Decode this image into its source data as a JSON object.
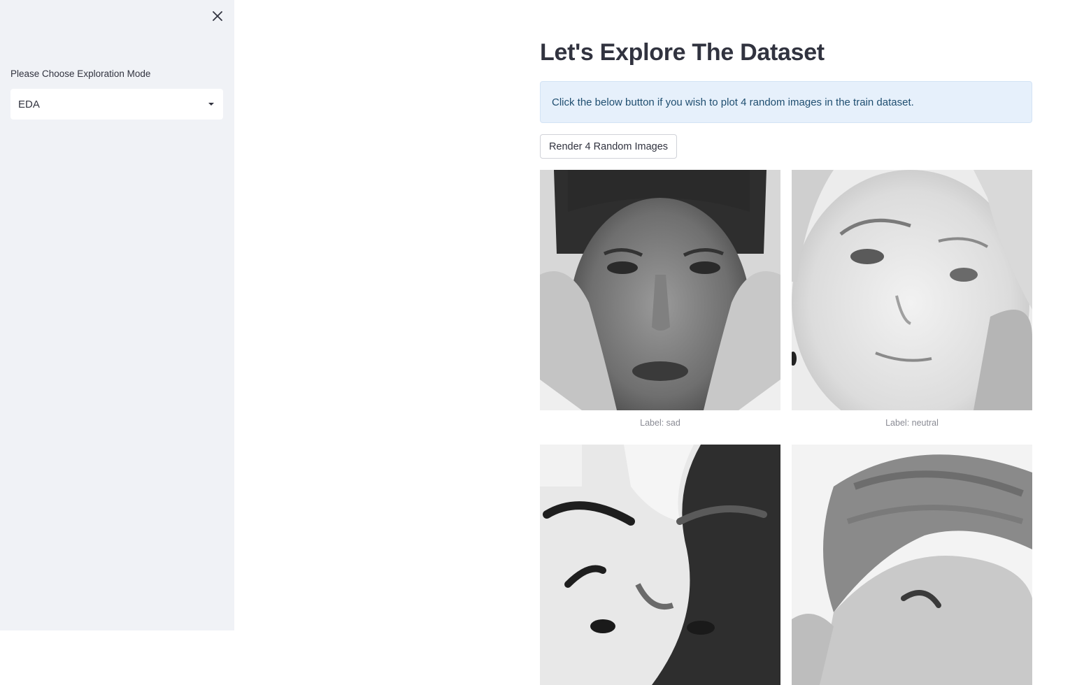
{
  "sidebar": {
    "close_icon": "close-icon",
    "mode_label": "Please Choose Exploration Mode",
    "mode_selected": "EDA",
    "dropdown_icon": "caret-down-icon"
  },
  "main": {
    "title": "Let's Explore The Dataset",
    "info_text": "Click the below button if you wish to plot 4 random images in the train dataset.",
    "render_button_label": "Render 4 Random Images",
    "images": [
      {
        "caption": "Label: sad"
      },
      {
        "caption": "Label: neutral"
      },
      {
        "caption": ""
      },
      {
        "caption": ""
      }
    ]
  },
  "colors": {
    "sidebar_bg": "#f0f2f6",
    "info_bg": "#e6f0fb",
    "info_text": "#1f4e70",
    "text": "#31333f"
  }
}
